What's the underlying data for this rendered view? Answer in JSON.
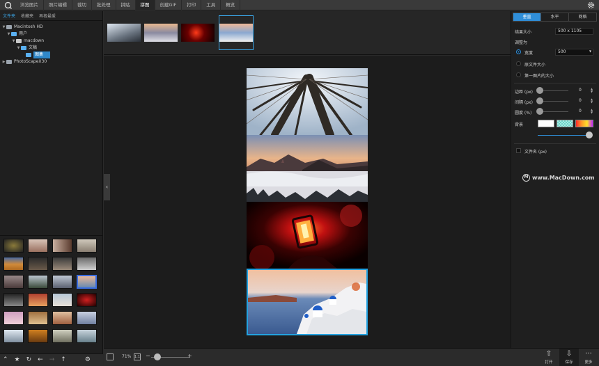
{
  "menubar": {
    "tabs": [
      "浏览图片",
      "照片编辑",
      "裁切",
      "批处理",
      "拼贴",
      "拼图",
      "创建GIF",
      "打印",
      "工具",
      "概览"
    ],
    "active_index": 5
  },
  "left_panel": {
    "tabs": [
      "文件夹",
      "收藏夹",
      "再者最爱"
    ],
    "active_tab": 0,
    "tree": [
      {
        "label": "Macintosh HD",
        "indent": 0,
        "twisty": "▼",
        "icon": "drive-icon"
      },
      {
        "label": "用户",
        "indent": 1,
        "twisty": "▼",
        "icon": "folder-icon"
      },
      {
        "label": "macdown",
        "indent": 2,
        "twisty": "▼",
        "icon": "home-icon"
      },
      {
        "label": "文稿",
        "indent": 3,
        "twisty": "▼",
        "icon": "folder-icon"
      },
      {
        "label": "图集",
        "indent": 4,
        "twisty": "",
        "icon": "folder-icon",
        "selected": true
      },
      {
        "label": "PhotoScapeX30",
        "indent": 0,
        "twisty": "▶",
        "icon": "drive-icon"
      }
    ],
    "bottom_icons": [
      "chevron-up-icon",
      "star-icon",
      "refresh-icon",
      "arrow-left-icon",
      "arrow-right-icon",
      "arrow-up-icon",
      "gear-icon"
    ]
  },
  "canvas": {
    "zoom": "71%",
    "one_to_one": "1:1"
  },
  "bottom_actions": {
    "open": "打开",
    "save": "保存",
    "more": "更多"
  },
  "right_panel": {
    "tabs": [
      "垂直",
      "水平",
      "网格"
    ],
    "active_tab": 0,
    "result_size_label": "结果大小",
    "result_size_value": "500 x 1105",
    "adjust_label": "调整为",
    "radio_width": "宽度",
    "width_value": "500",
    "radio_original": "原文件大小",
    "radio_first": "第一图片的大小",
    "margin_label": "边距 (px)",
    "margin_value": "0",
    "spacing_label": "间隔 (px)",
    "spacing_value": "0",
    "roundness_label": "圆度 (%)",
    "roundness_value": "0",
    "background_label": "背景",
    "filename_label": "文件名 (px)",
    "watermark": "www.MacDown.com",
    "accent": "#2f8ed8"
  }
}
